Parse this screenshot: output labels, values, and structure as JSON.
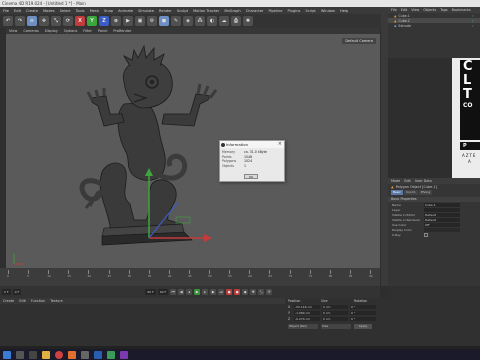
{
  "window": {
    "title": "Cinema 4D R19.024 - [Untitled 1 *] - Main"
  },
  "menubar": [
    "File",
    "Edit",
    "Create",
    "Modes",
    "Select",
    "Tools",
    "Mesh",
    "Snap",
    "Animate",
    "Simulate",
    "Render",
    "Sculpt",
    "Motion Tracker",
    "MoGraph",
    "Character",
    "Pipeline",
    "Plugins",
    "Script",
    "Window",
    "Help"
  ],
  "toolbar": {
    "x": "X",
    "y": "Y",
    "z": "Z"
  },
  "viewport_menu": [
    "View",
    "Cameras",
    "Display",
    "Options",
    "Filter",
    "Panel",
    "ProRender"
  ],
  "viewport": {
    "camera_label": "Default Camera"
  },
  "dialog": {
    "title": "Information",
    "rows": [
      {
        "key": "Memory",
        "value": "ca. 31.0 kByte"
      },
      {
        "key": "Points",
        "value": "1048"
      },
      {
        "key": "Polygons",
        "value": "1024"
      },
      {
        "key": "Objects",
        "value": "1"
      }
    ],
    "ok": "OK"
  },
  "objects_menu": [
    "File",
    "Edit",
    "View",
    "Objects",
    "Tags",
    "Bookmarks"
  ],
  "objects": [
    {
      "name": "Cube.1",
      "active": false
    },
    {
      "name": "Cube.2",
      "active": true
    },
    {
      "name": "Extrude",
      "active": false
    }
  ],
  "logo": {
    "big1": "C",
    "big2": "L",
    "big3": "T",
    "small": "CO",
    "p": "P",
    "azt": "AZTE",
    "a": "A"
  },
  "attributes": {
    "menu": [
      "Mode",
      "Edit",
      "User Data"
    ],
    "title": "Polygon Object [Cube.1]",
    "tabs": [
      "Basic",
      "Coord.",
      "Phong"
    ],
    "section": "Basic Properties",
    "fields": [
      {
        "key": "Name",
        "value": "Cube.1",
        "gray": false
      },
      {
        "key": "Layer",
        "value": "",
        "gray": false
      },
      {
        "key": "Visible in Editor",
        "value": "Default",
        "gray": false
      },
      {
        "key": "Visible in Renderer",
        "value": "Default",
        "gray": false
      },
      {
        "key": "Use Color",
        "value": "Off",
        "gray": false
      },
      {
        "key": "Display Color",
        "value": "",
        "gray": true
      },
      {
        "key": "X-Ray",
        "value": "",
        "gray": false
      }
    ]
  },
  "timeline": {
    "ticks": [
      "0",
      "5",
      "10",
      "15",
      "20",
      "25",
      "30",
      "35",
      "40",
      "45",
      "50",
      "55",
      "60",
      "65",
      "70",
      "75",
      "80",
      "85",
      "90"
    ]
  },
  "playbar": {
    "start": "0 F",
    "cur": "0 F",
    "end": "90 F",
    "end2": "90 F"
  },
  "materials_menu": [
    "Create",
    "Edit",
    "Function",
    "Texture"
  ],
  "coords": {
    "headers": [
      "Position",
      "Size",
      "Rotation"
    ],
    "rows": [
      {
        "ax": "X",
        "p": "-52.116 cm",
        "s": "0 cm",
        "r": "0 °"
      },
      {
        "ax": "Y",
        "p": "-1.089 cm",
        "s": "0 cm",
        "r": "0 °"
      },
      {
        "ax": "Z",
        "p": "-0.274 cm",
        "s": "0 cm",
        "r": "0 °"
      }
    ],
    "mode": "Object (Rel)",
    "size_mode": "Size",
    "apply": "Apply"
  },
  "colors": {
    "viewport_bg": "#5a5a5a",
    "accent": "#5a78a8"
  }
}
